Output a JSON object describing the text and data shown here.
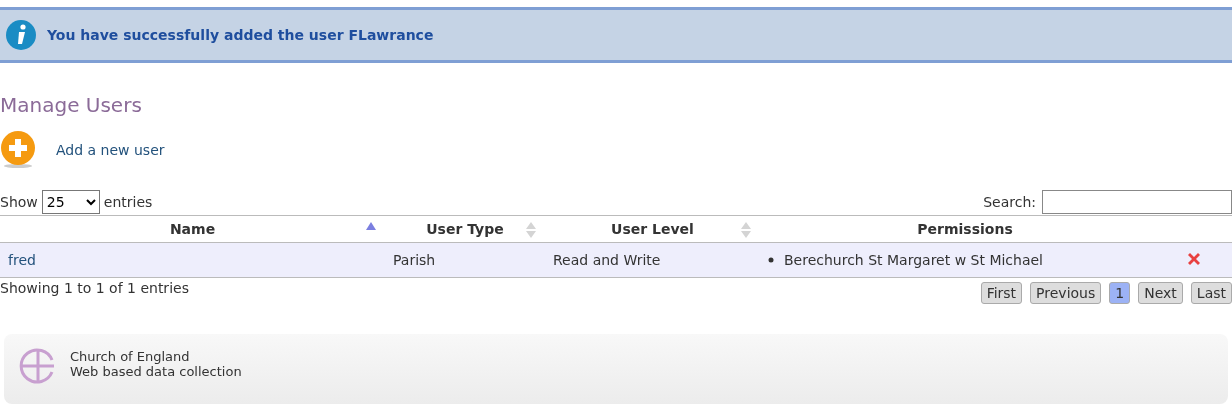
{
  "notice": {
    "text": "You have successfully added the user FLawrance"
  },
  "title": "Manage Users",
  "add_link": "Add a new user",
  "length": {
    "prefix": "Show",
    "value": "25",
    "suffix": "entries"
  },
  "search": {
    "label": "Search:"
  },
  "table": {
    "columns": [
      {
        "label": "Name",
        "sortable": true,
        "sorted": true
      },
      {
        "label": "User Type",
        "sortable": true,
        "sorted": false
      },
      {
        "label": "User Level",
        "sortable": true,
        "sorted": false
      },
      {
        "label": "Permissions",
        "sortable": false
      }
    ],
    "rows": [
      {
        "name": "fred",
        "user_type": "Parish",
        "user_level": "Read and Write",
        "permissions": [
          "Berechurch St Margaret w St Michael"
        ]
      }
    ]
  },
  "info": "Showing 1 to 1 of 1 entries",
  "pagination": [
    {
      "label": "First",
      "selected": false
    },
    {
      "label": "Previous",
      "selected": false
    },
    {
      "label": "1",
      "selected": true
    },
    {
      "label": "Next",
      "selected": false
    },
    {
      "label": "Last",
      "selected": false
    }
  ],
  "footer": {
    "lines": [
      "Church of England",
      "Web based data collection"
    ]
  }
}
